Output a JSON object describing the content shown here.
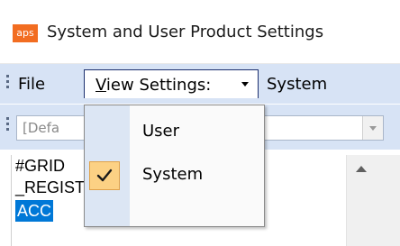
{
  "window": {
    "title": "System and User Product Settings",
    "app_icon_text": "aps"
  },
  "menubar": {
    "file": "File",
    "view_settings_underlined": "V",
    "view_settings_rest": "iew Settings:",
    "system": "System"
  },
  "toolbar": {
    "combo_value": "[Defa"
  },
  "list": {
    "items": [
      "#GRID",
      "_REGISTER",
      "ACC"
    ],
    "selected_index": 2
  },
  "dropdown": {
    "items": [
      {
        "label": "User",
        "checked": false
      },
      {
        "label": "System",
        "checked": true
      }
    ]
  },
  "colors": {
    "accent": "#0078d7",
    "menubar": "#d7e3f5",
    "check_highlight": "#fcd184",
    "app_icon": "#f26d21"
  }
}
